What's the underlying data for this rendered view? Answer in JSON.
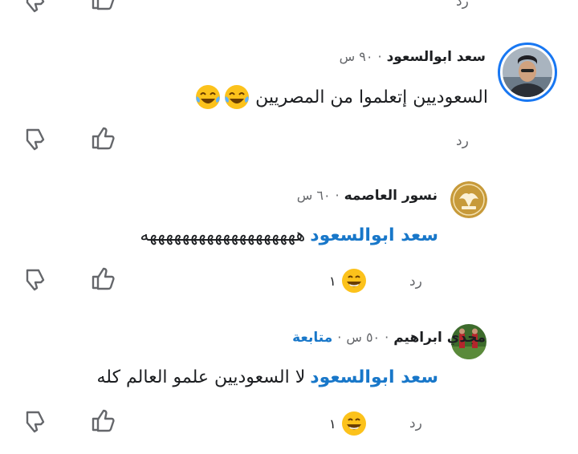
{
  "top_row": {
    "reply_label": "رد"
  },
  "comments": [
    {
      "author": "سعد ابوالسعود",
      "time": "٩٠ س",
      "follow_label": "",
      "mention": "",
      "text": "السعوديين إتعلموا من المصريين",
      "emoji": [
        "tears-of-joy",
        "tears-of-joy"
      ],
      "reply_label": "رد",
      "reaction_count": ""
    },
    {
      "author": "نسور العاصمه",
      "time": "٦٠ س",
      "follow_label": "",
      "mention": "سعد ابوالسعود",
      "text": "هههههههههههههههههههه",
      "reply_label": "رد",
      "reaction_count": "١"
    },
    {
      "author": "مجدي ابراهيم",
      "time": "٥٠ س",
      "follow_label": "متابعة",
      "mention": "سعد ابوالسعود",
      "text": "لا السعوديين علمو العالم كله",
      "reply_label": "رد",
      "reaction_count": "١"
    }
  ],
  "separator": "·",
  "colors": {
    "link": "#1877c9",
    "meta": "#65676b",
    "avatar_ring": "#1877f2",
    "emoji": "#fcc21b"
  }
}
